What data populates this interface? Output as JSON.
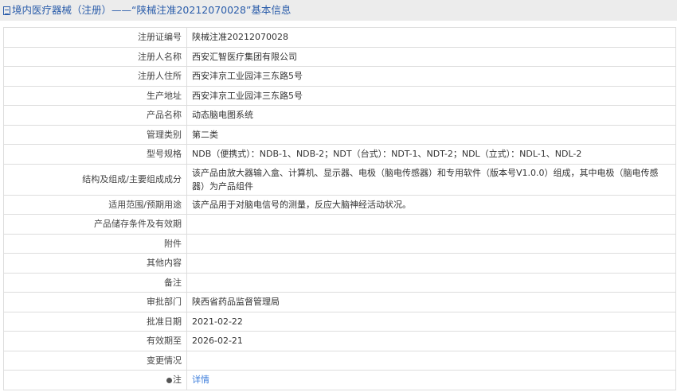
{
  "header": {
    "title": "境内医疗器械（注册）——“陕械注准20212070028”基本信息",
    "icon": "document-icon"
  },
  "rows": [
    {
      "label": "注册证编号",
      "value": "陕械注准20212070028"
    },
    {
      "label": "注册人名称",
      "value": "西安汇智医疗集团有限公司"
    },
    {
      "label": "注册人住所",
      "value": "西安沣京工业园沣三东路5号"
    },
    {
      "label": "生产地址",
      "value": "西安沣京工业园沣三东路5号"
    },
    {
      "label": "产品名称",
      "value": "动态脑电图系统"
    },
    {
      "label": "管理类别",
      "value": "第二类"
    },
    {
      "label": "型号规格",
      "value": "NDB（便携式）：NDB-1、NDB-2；NDT（台式）：NDT-1、NDT-2；NDL（立式）：NDL-1、NDL-2"
    },
    {
      "label": "结构及组成/主要组成成分",
      "value": "该产品由放大器输入盒、计算机、显示器、电极（脑电传感器）和专用软件（版本号V1.0.0）组成，其中电极（脑电传感器）为产品组件"
    },
    {
      "label": "适用范围/预期用途",
      "value": "该产品用于对脑电信号的测量，反应大脑神经活动状况。"
    },
    {
      "label": "产品储存条件及有效期",
      "value": ""
    },
    {
      "label": "附件",
      "value": ""
    },
    {
      "label": "其他内容",
      "value": ""
    },
    {
      "label": "备注",
      "value": ""
    },
    {
      "label": "审批部门",
      "value": "陕西省药品监督管理局"
    },
    {
      "label": "批准日期",
      "value": "2021-02-22"
    },
    {
      "label": "有效期至",
      "value": "2026-02-21"
    },
    {
      "label": "变更情况",
      "value": ""
    }
  ],
  "note": {
    "label": "注",
    "link": "详情"
  }
}
